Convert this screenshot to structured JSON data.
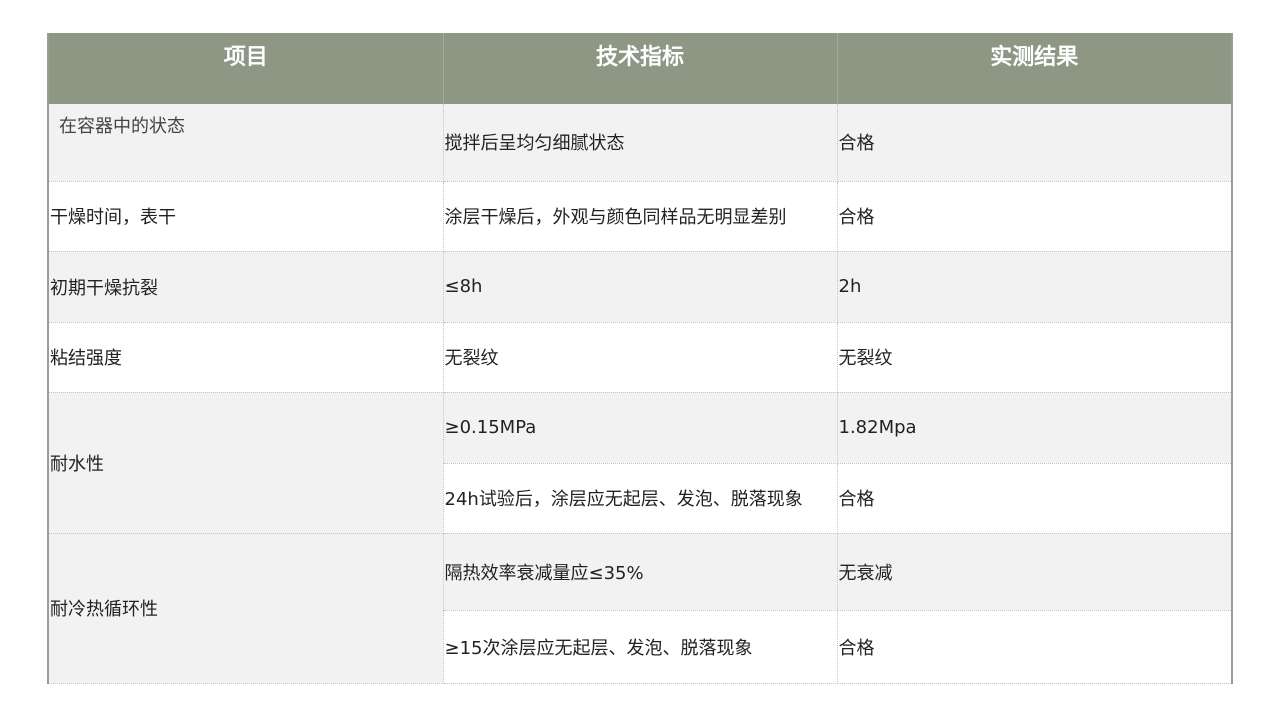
{
  "table": {
    "headers": [
      "项目",
      "技术指标",
      "实测结果"
    ],
    "rows": [
      {
        "item": "在容器中的状态",
        "spec": "搅拌后呈均匀细腻状态",
        "result": "合格"
      },
      {
        "item": "干燥时间，表干",
        "spec": "涂层干燥后，外观与颜色同样品无明显差别",
        "result": "合格"
      },
      {
        "item": "初期干燥抗裂",
        "spec": "≤8h",
        "result": "2h"
      },
      {
        "item": "粘结强度",
        "spec": "无裂纹",
        "result": "无裂纹"
      },
      {
        "item": "耐水性",
        "sub": [
          {
            "spec": "≥0.15MPa",
            "result": "1.82Mpa"
          },
          {
            "spec": "24h试验后，涂层应无起层、发泡、脱落现象",
            "result": "合格"
          }
        ]
      },
      {
        "item": "耐冷热循环性",
        "sub": [
          {
            "spec": "隔热效率衰减量应≤35%",
            "result": "无衰减"
          },
          {
            "spec": "≥15次涂层应无起层、发泡、脱落现象",
            "result": "合格"
          }
        ]
      }
    ]
  }
}
